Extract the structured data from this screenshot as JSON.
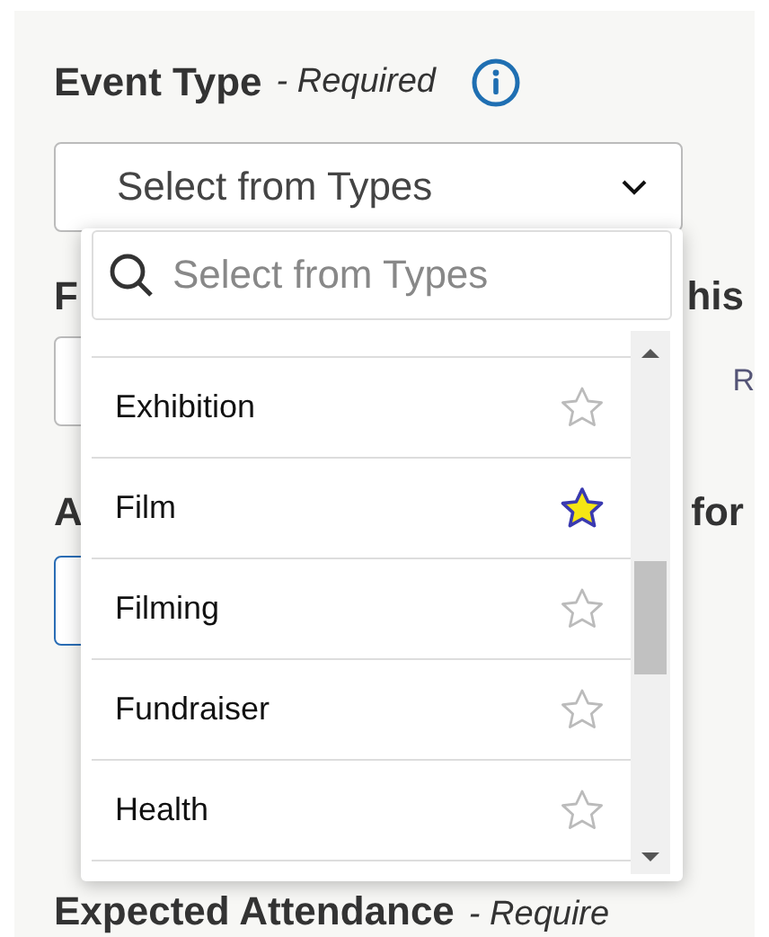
{
  "field": {
    "label": "Event Type",
    "required_note": "- Required",
    "select_placeholder": "Select from Types"
  },
  "dropdown": {
    "search_placeholder": "Select from Types",
    "options": [
      {
        "label": "Exhibition",
        "favorite": false
      },
      {
        "label": "Film",
        "favorite": true
      },
      {
        "label": "Filming",
        "favorite": false
      },
      {
        "label": "Fundraiser",
        "favorite": false
      },
      {
        "label": "Health",
        "favorite": false
      }
    ]
  },
  "background": {
    "heading_2_start": "F",
    "heading_2_end": "his",
    "field_2_side_text": "R",
    "heading_3_start": "A",
    "heading_3_end": "for",
    "heading_4": "Expected Attendance",
    "heading_4_note": "- Require"
  }
}
